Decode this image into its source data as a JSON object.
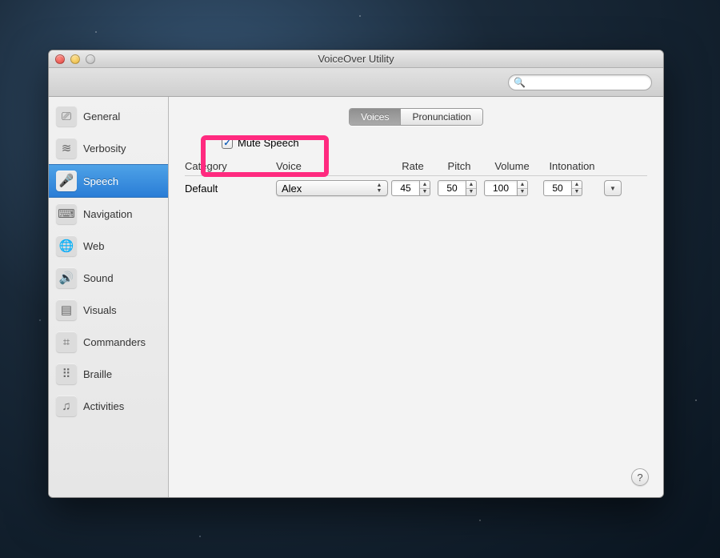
{
  "window": {
    "title": "VoiceOver Utility"
  },
  "search": {
    "placeholder": ""
  },
  "sidebar": {
    "items": [
      {
        "label": "General",
        "icon": "⎚"
      },
      {
        "label": "Verbosity",
        "icon": "≋"
      },
      {
        "label": "Speech",
        "icon": "🎤"
      },
      {
        "label": "Navigation",
        "icon": "⌨"
      },
      {
        "label": "Web",
        "icon": "🌐"
      },
      {
        "label": "Sound",
        "icon": "🔊"
      },
      {
        "label": "Visuals",
        "icon": "▤"
      },
      {
        "label": "Commanders",
        "icon": "⌗"
      },
      {
        "label": "Braille",
        "icon": "⠿"
      },
      {
        "label": "Activities",
        "icon": "♫"
      }
    ],
    "selected_index": 2
  },
  "tabs": {
    "items": [
      "Voices",
      "Pronunciation"
    ],
    "active_index": 0
  },
  "mute": {
    "label": "Mute Speech",
    "checked": true
  },
  "columns": {
    "category": "Category",
    "voice": "Voice",
    "rate": "Rate",
    "pitch": "Pitch",
    "volume": "Volume",
    "intonation": "Intonation"
  },
  "rows": [
    {
      "category": "Default",
      "voice": "Alex",
      "rate": "45",
      "pitch": "50",
      "volume": "100",
      "intonation": "50"
    }
  ],
  "help": "?"
}
